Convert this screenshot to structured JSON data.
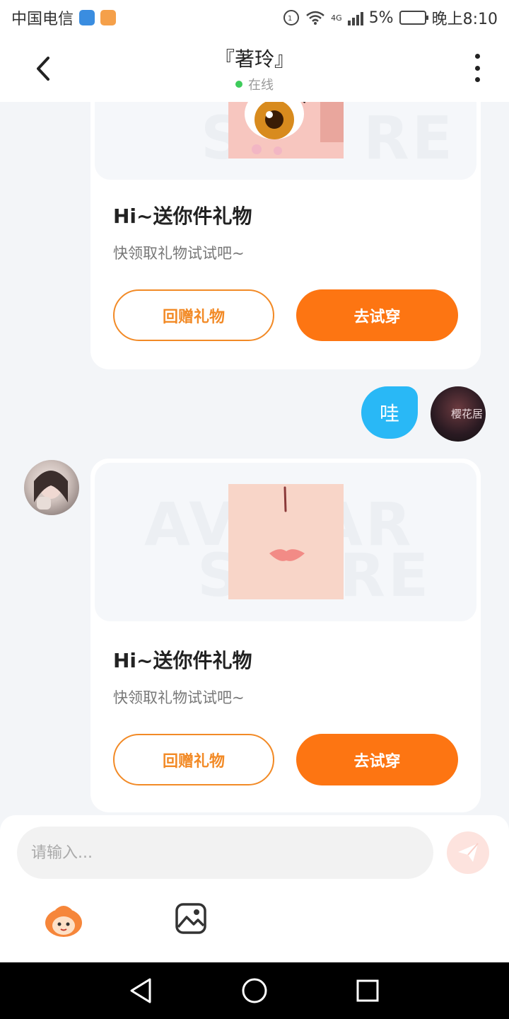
{
  "status_bar": {
    "carrier": "中国电信",
    "network": "4G",
    "battery": "5%",
    "time": "晚上8:10"
  },
  "header": {
    "title": "『著玲』",
    "status": "在线"
  },
  "messages": [
    {
      "type": "gift",
      "title": "Hi~送你件礼物",
      "subtitle": "快领取礼物试试吧~",
      "return_label": "回赠礼物",
      "try_label": "去试穿"
    },
    {
      "type": "text",
      "from": "me",
      "text": "哇",
      "avatar_text": "樱花居"
    },
    {
      "type": "gift",
      "title": "Hi~送你件礼物",
      "subtitle": "快领取礼物试试吧~",
      "return_label": "回赠礼物",
      "try_label": "去试穿",
      "watermark": "AVATAR STORE"
    }
  ],
  "input": {
    "placeholder": "请输入..."
  },
  "colors": {
    "accent_orange": "#fd7512",
    "bubble_blue": "#29b8f6",
    "online_green": "#3ecb5b"
  }
}
